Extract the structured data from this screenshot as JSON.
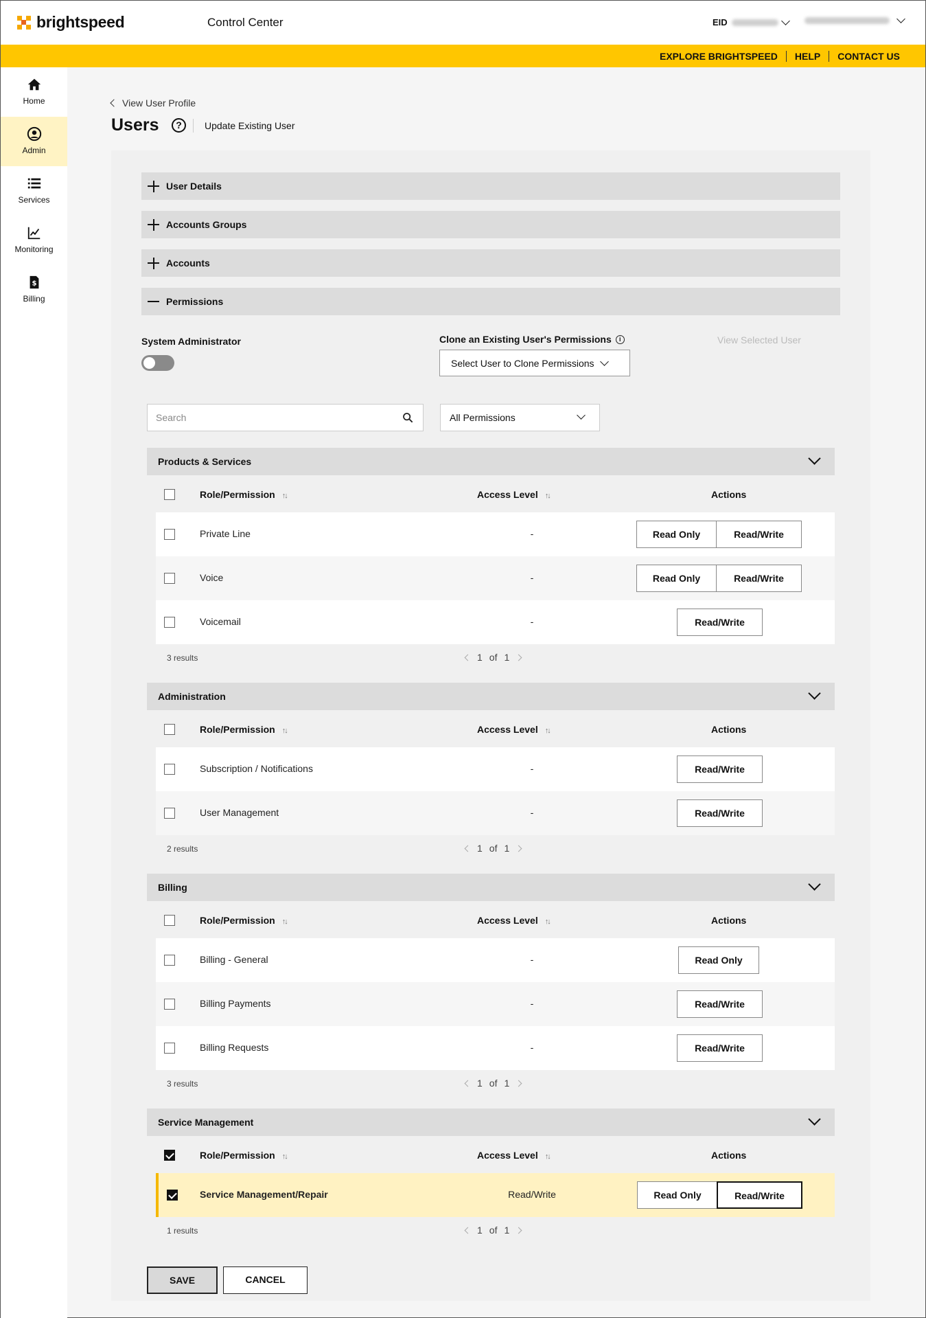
{
  "header": {
    "brand": "brightspeed",
    "app_title": "Control Center",
    "eid_label": "EID",
    "links": [
      "EXPLORE BRIGHTSPEED",
      "HELP",
      "CONTACT US"
    ]
  },
  "sidebar": {
    "items": [
      {
        "label": "Home",
        "icon": "home-icon"
      },
      {
        "label": "Admin",
        "icon": "user-circle-icon",
        "active": true
      },
      {
        "label": "Services",
        "icon": "list-icon"
      },
      {
        "label": "Monitoring",
        "icon": "chart-line-icon"
      },
      {
        "label": "Billing",
        "icon": "invoice-icon"
      }
    ]
  },
  "page": {
    "breadcrumb": "View User Profile",
    "title": "Users",
    "subtitle": "Update Existing User"
  },
  "accordion": [
    {
      "label": "User Details",
      "expanded": false
    },
    {
      "label": "Accounts Groups",
      "expanded": false
    },
    {
      "label": "Accounts",
      "expanded": false
    },
    {
      "label": "Permissions",
      "expanded": true
    }
  ],
  "permissions": {
    "system_admin_label": "System Administrator",
    "system_admin_on": false,
    "clone_label": "Clone an Existing User's Permissions",
    "clone_select": "Select User to Clone Permissions",
    "view_selected": "View Selected User",
    "search_placeholder": "Search",
    "filter_value": "All Permissions",
    "columns": {
      "role": "Role/Permission",
      "access": "Access Level",
      "actions": "Actions"
    },
    "sections": [
      {
        "title": "Products & Services",
        "results": "3 results",
        "page": {
          "cur": "1",
          "of": "of",
          "total": "1"
        },
        "rows": [
          {
            "name": "Private Line",
            "level": "-"
          },
          {
            "name": "Voice",
            "level": "-"
          },
          {
            "name": "Voicemail",
            "level": "-"
          }
        ]
      },
      {
        "title": "Administration",
        "results": "2 results",
        "page": {
          "cur": "1",
          "of": "of",
          "total": "1"
        },
        "rows": [
          {
            "name": "Subscription / Notifications",
            "level": "-"
          },
          {
            "name": "User Management",
            "level": "-"
          }
        ]
      },
      {
        "title": "Billing",
        "results": "3 results",
        "page": {
          "cur": "1",
          "of": "of",
          "total": "1"
        },
        "rows": [
          {
            "name": "Billing - General",
            "level": "-"
          },
          {
            "name": "Billing Payments",
            "level": "-"
          },
          {
            "name": "Billing Requests",
            "level": "-"
          }
        ]
      },
      {
        "title": "Service Management",
        "results": "1 results",
        "page": {
          "cur": "1",
          "of": "of",
          "total": "1"
        },
        "rows": [
          {
            "name": "Service Management/Repair",
            "level": "Read/Write",
            "checked": true
          }
        ]
      }
    ],
    "btn": {
      "read_only": "Read Only",
      "read_write": "Read/Write"
    }
  },
  "actions": {
    "save": "SAVE",
    "cancel": "CANCEL"
  },
  "colors": {
    "brand_yellow": "#ffc600",
    "brand_orange": "#f5a800",
    "selected_row": "#fff2c2"
  }
}
